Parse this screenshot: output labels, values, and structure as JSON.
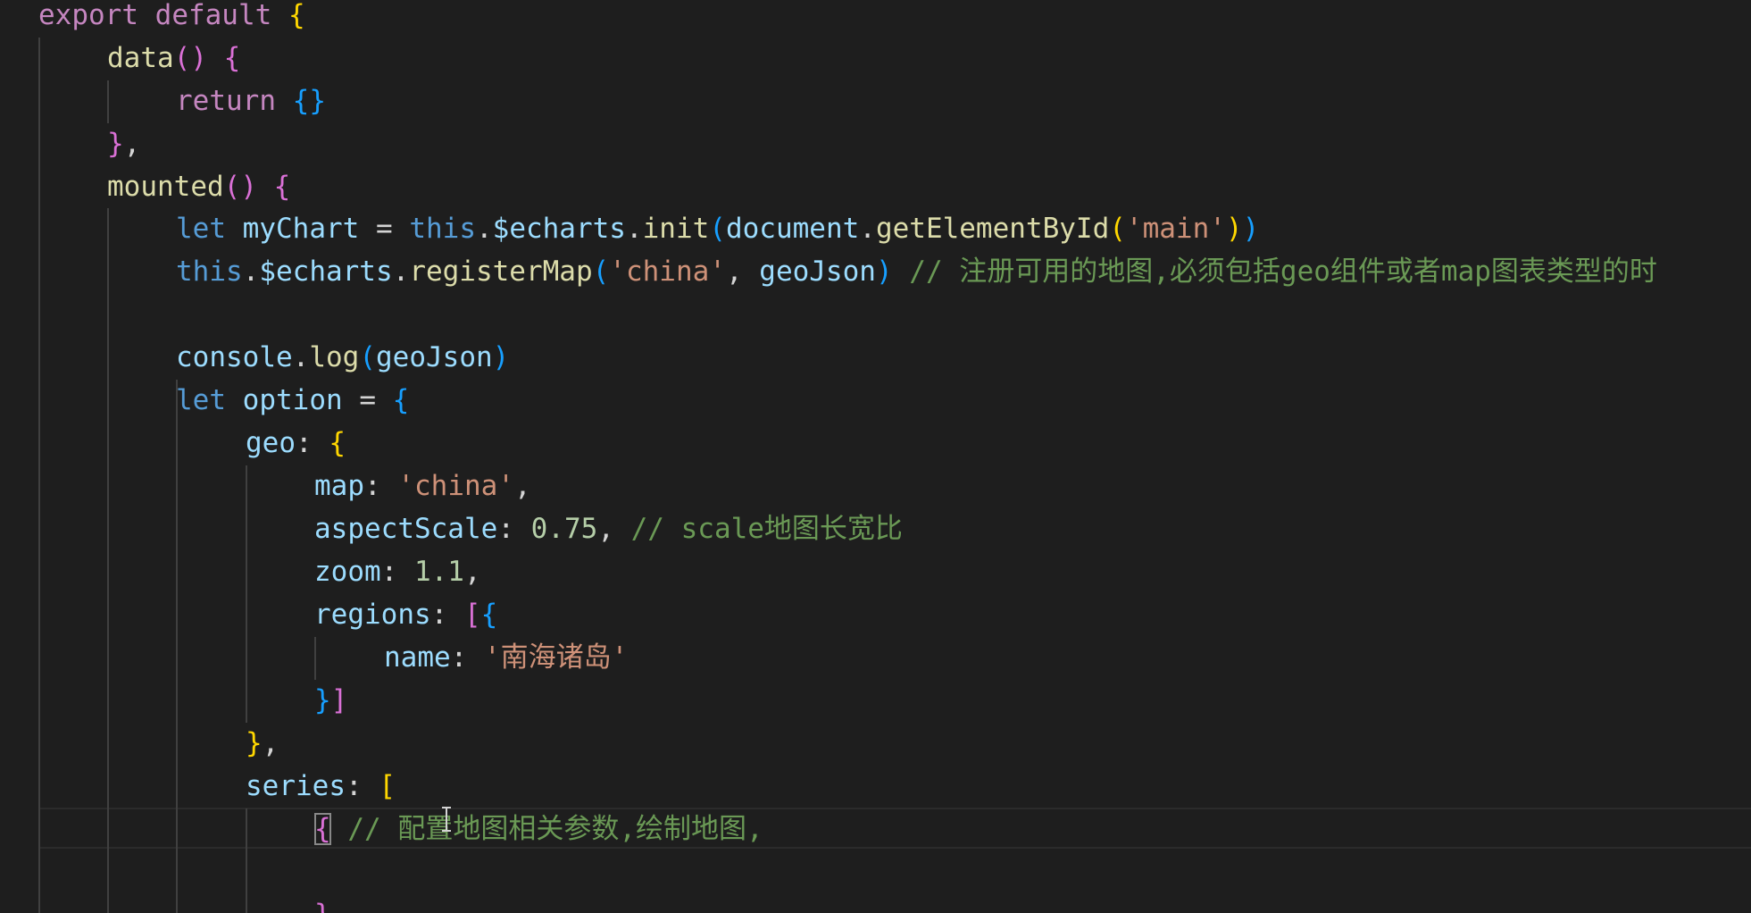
{
  "editor": {
    "colors": {
      "background": "#1e1e1e",
      "keyword": "#c586c0",
      "storage": "#569cd6",
      "function": "#dcdcaa",
      "variable": "#9cdcfe",
      "string": "#ce9178",
      "number": "#b5cea8",
      "comment": "#6a9955",
      "bracket_level1": "#ffd700",
      "bracket_level2": "#da70d6",
      "bracket_level3": "#179fff"
    },
    "icons": [
      "text-cursor-icon"
    ],
    "lines": [
      {
        "tokens": [
          [
            "kw",
            "export"
          ],
          [
            "pl",
            " "
          ],
          [
            "kw",
            "default"
          ],
          [
            "pl",
            " "
          ],
          [
            "b1",
            "{"
          ]
        ]
      },
      {
        "tokens": [
          [
            "fn",
            "data"
          ],
          [
            "b2",
            "()"
          ],
          [
            "pl",
            " "
          ],
          [
            "b2",
            "{"
          ]
        ]
      },
      {
        "tokens": [
          [
            "kw",
            "return"
          ],
          [
            "pl",
            " "
          ],
          [
            "b3",
            "{}"
          ]
        ]
      },
      {
        "tokens": [
          [
            "b2",
            "}"
          ],
          [
            "pl",
            ","
          ]
        ]
      },
      {
        "tokens": [
          [
            "fn",
            "mounted"
          ],
          [
            "b2",
            "()"
          ],
          [
            "pl",
            " "
          ],
          [
            "b2",
            "{"
          ]
        ]
      },
      {
        "tokens": [
          [
            "st",
            "let"
          ],
          [
            "pl",
            " "
          ],
          [
            "vr",
            "myChart"
          ],
          [
            "pl",
            " = "
          ],
          [
            "st",
            "this"
          ],
          [
            "pl",
            "."
          ],
          [
            "vr",
            "$echarts"
          ],
          [
            "pl",
            "."
          ],
          [
            "fn",
            "init"
          ],
          [
            "b3",
            "("
          ],
          [
            "vr",
            "document"
          ],
          [
            "pl",
            "."
          ],
          [
            "fn",
            "getElementById"
          ],
          [
            "b1",
            "("
          ],
          [
            "str",
            "'main'"
          ],
          [
            "b1",
            ")"
          ],
          [
            "b3",
            ")"
          ]
        ]
      },
      {
        "tokens": [
          [
            "st",
            "this"
          ],
          [
            "pl",
            "."
          ],
          [
            "vr",
            "$echarts"
          ],
          [
            "pl",
            "."
          ],
          [
            "fn",
            "registerMap"
          ],
          [
            "b3",
            "("
          ],
          [
            "str",
            "'china'"
          ],
          [
            "pl",
            ", "
          ],
          [
            "vr",
            "geoJson"
          ],
          [
            "b3",
            ")"
          ],
          [
            "pl",
            " "
          ],
          [
            "cmt",
            "// 注册可用的地图,必须包括geo组件或者map图表类型的时"
          ]
        ]
      },
      {
        "tokens": []
      },
      {
        "tokens": [
          [
            "vr",
            "console"
          ],
          [
            "pl",
            "."
          ],
          [
            "fn",
            "log"
          ],
          [
            "b3",
            "("
          ],
          [
            "vr",
            "geoJson"
          ],
          [
            "b3",
            ")"
          ]
        ]
      },
      {
        "tokens": [
          [
            "st",
            "let"
          ],
          [
            "pl",
            " "
          ],
          [
            "vr",
            "option"
          ],
          [
            "pl",
            " = "
          ],
          [
            "b3",
            "{"
          ]
        ]
      },
      {
        "tokens": [
          [
            "vr",
            "geo"
          ],
          [
            "pl",
            ": "
          ],
          [
            "b1",
            "{"
          ]
        ]
      },
      {
        "tokens": [
          [
            "vr",
            "map"
          ],
          [
            "pl",
            ": "
          ],
          [
            "str",
            "'china'"
          ],
          [
            "pl",
            ","
          ]
        ]
      },
      {
        "tokens": [
          [
            "vr",
            "aspectScale"
          ],
          [
            "pl",
            ": "
          ],
          [
            "num",
            "0.75"
          ],
          [
            "pl",
            ", "
          ],
          [
            "cmt",
            "// scale地图长宽比"
          ]
        ]
      },
      {
        "tokens": [
          [
            "vr",
            "zoom"
          ],
          [
            "pl",
            ": "
          ],
          [
            "num",
            "1.1"
          ],
          [
            "pl",
            ","
          ]
        ]
      },
      {
        "tokens": [
          [
            "vr",
            "regions"
          ],
          [
            "pl",
            ": "
          ],
          [
            "b2",
            "["
          ],
          [
            "b3",
            "{"
          ]
        ]
      },
      {
        "tokens": [
          [
            "vr",
            "name"
          ],
          [
            "pl",
            ": "
          ],
          [
            "str",
            "'南海诸岛'"
          ]
        ]
      },
      {
        "tokens": [
          [
            "b3",
            "}"
          ],
          [
            "b2",
            "]"
          ]
        ]
      },
      {
        "tokens": [
          [
            "b1",
            "}"
          ],
          [
            "pl",
            ","
          ]
        ]
      },
      {
        "tokens": [
          [
            "vr",
            "series"
          ],
          [
            "pl",
            ": "
          ],
          [
            "b1",
            "["
          ]
        ]
      },
      {
        "tokens": [
          [
            "b2",
            "{"
          ],
          [
            "pl",
            " "
          ],
          [
            "cmt",
            "// 配置地图相关参数,绘制地图,"
          ]
        ]
      },
      {
        "tokens": []
      },
      {
        "tokens": [
          [
            "b2",
            "}"
          ]
        ]
      }
    ]
  }
}
